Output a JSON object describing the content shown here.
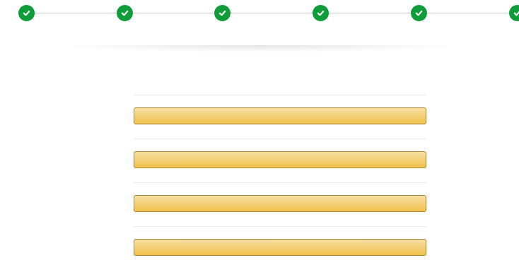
{
  "colors": {
    "step_complete": "#0f9d3a",
    "button_top": "#f7dfa5",
    "button_bottom": "#f0c14b",
    "button_border": "#a88734"
  },
  "stepper": {
    "steps": [
      {
        "label": "",
        "status": "complete",
        "icon": "check-icon"
      },
      {
        "label": "",
        "status": "complete",
        "icon": "check-icon"
      },
      {
        "label": "",
        "status": "complete",
        "icon": "check-icon"
      },
      {
        "label": "",
        "status": "complete",
        "icon": "check-icon"
      },
      {
        "label": "",
        "status": "complete",
        "icon": "check-icon"
      },
      {
        "label": "",
        "status": "complete",
        "icon": "check-icon"
      }
    ]
  },
  "panel": {
    "title": "",
    "options": [
      {
        "label": ""
      },
      {
        "label": ""
      },
      {
        "label": ""
      },
      {
        "label": ""
      }
    ]
  }
}
